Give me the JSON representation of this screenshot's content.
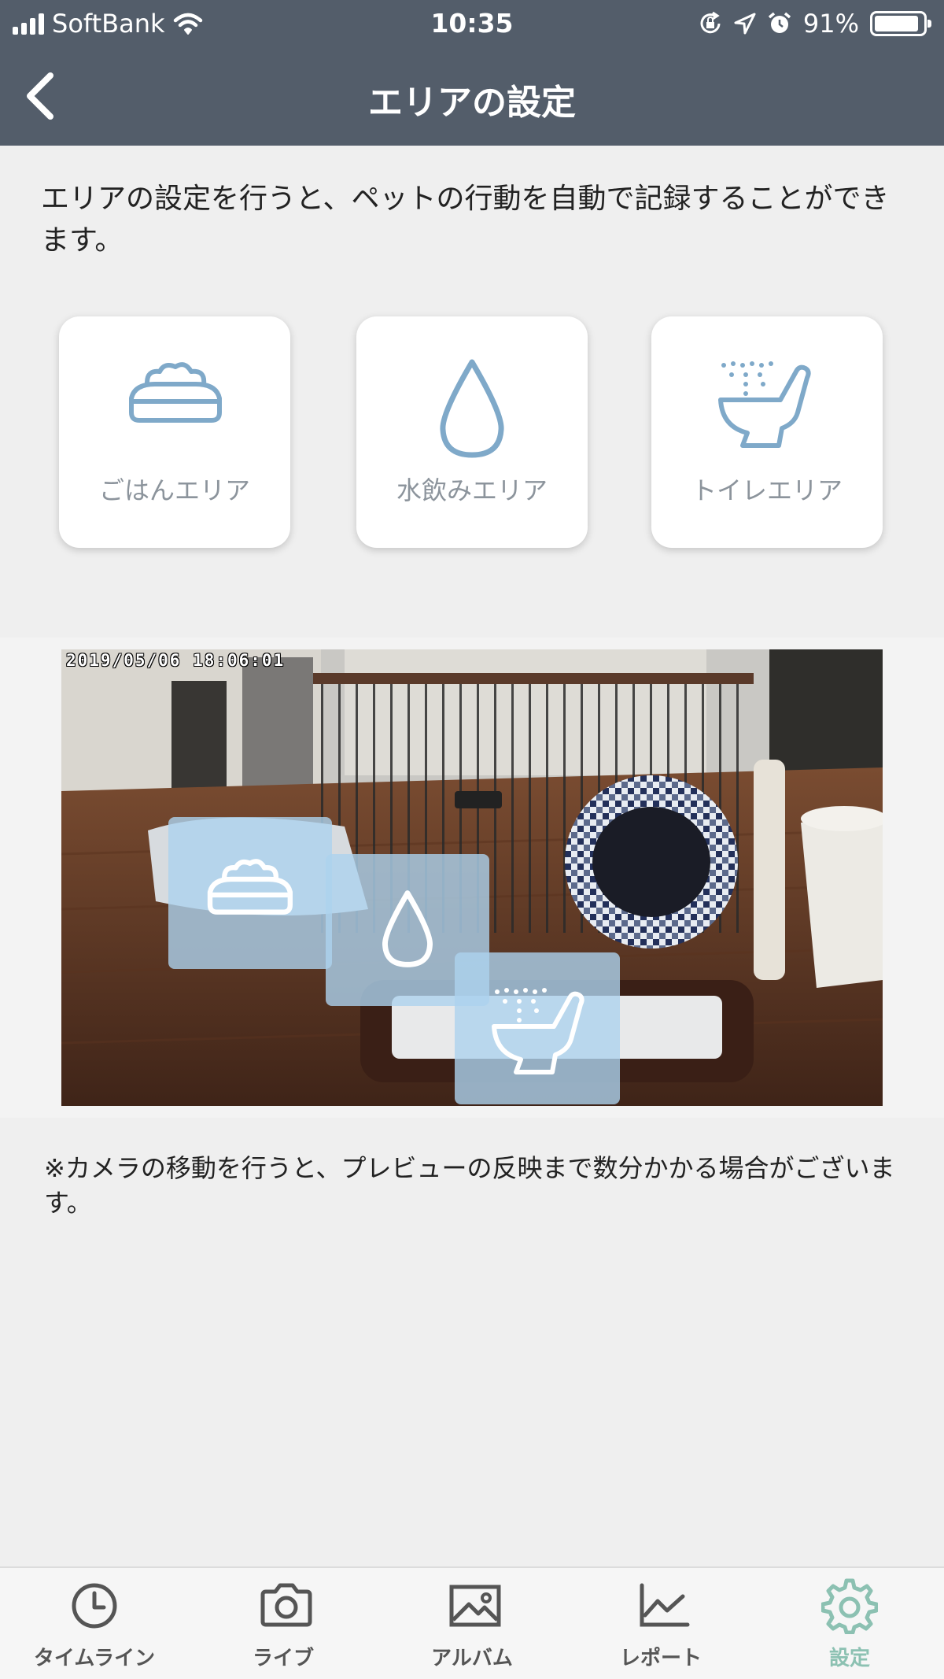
{
  "status_bar": {
    "carrier": "SoftBank",
    "time": "10:35",
    "battery": "91%",
    "battery_level": 0.91
  },
  "header": {
    "title": "エリアの設定",
    "back_icon": "chevron-left-icon"
  },
  "intro": "エリアの設定を行うと、ペットの行動を自動で記録することができます。",
  "area_cards": [
    {
      "label": "ごはんエリア",
      "icon": "food-bowl-icon"
    },
    {
      "label": "水飲みエリア",
      "icon": "water-drop-icon"
    },
    {
      "label": "トイレエリア",
      "icon": "toilet-icon"
    }
  ],
  "preview": {
    "timestamp": "2019/05/06  18:06:01"
  },
  "note": "※カメラの移動を行うと、プレビューの反映まで数分かかる場合がございます。",
  "tabs": [
    {
      "label": "タイムライン",
      "icon": "clock-icon"
    },
    {
      "label": "ライブ",
      "icon": "camera-icon"
    },
    {
      "label": "アルバム",
      "icon": "image-icon"
    },
    {
      "label": "レポート",
      "icon": "line-chart-icon"
    },
    {
      "label": "設定",
      "icon": "gear-icon"
    }
  ],
  "active_tab": "設定",
  "colors": {
    "header": "#535d6a",
    "icon_blue": "#7fa9c9",
    "active_tab": "#8cc1b2",
    "overlay": "#add2ee"
  }
}
